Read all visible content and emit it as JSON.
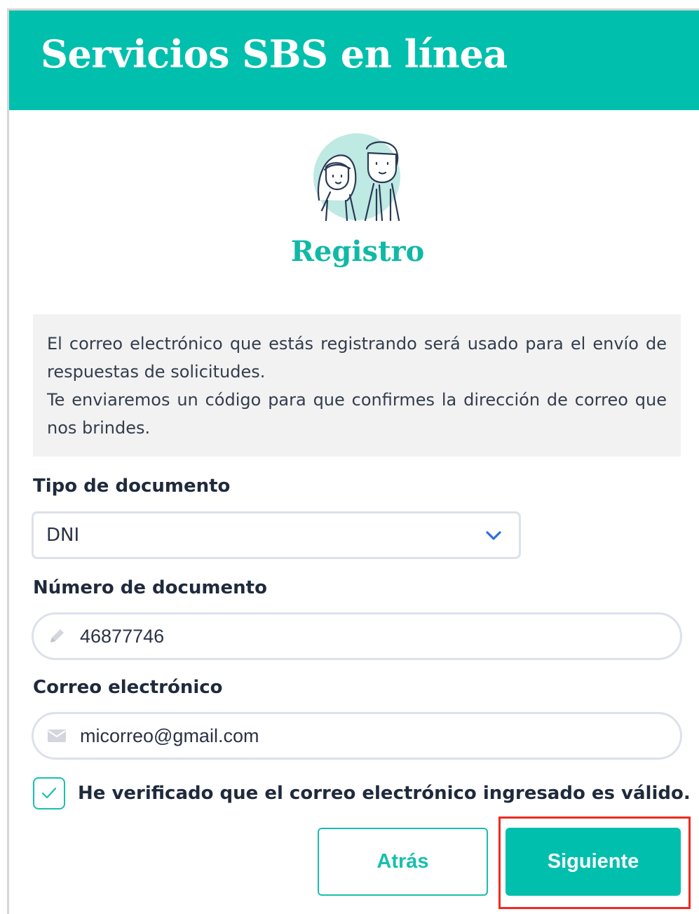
{
  "header": {
    "title": "Servicios SBS en línea"
  },
  "page": {
    "title": "Registro"
  },
  "notice": {
    "line1": "El correo electrónico que estás registrando será usado para el envío de respuestas de solicitudes.",
    "line2": "Te enviaremos un código para que confirmes la dirección de correo que nos brindes."
  },
  "form": {
    "doc_type": {
      "label": "Tipo de documento",
      "value": "DNI"
    },
    "doc_number": {
      "label": "Número de documento",
      "value": "46877746"
    },
    "email": {
      "label": "Correo electrónico",
      "value": "micorreo@gmail.com"
    },
    "verify": {
      "label": "He verificado que el correo electrónico ingresado es válido.",
      "checked": true
    }
  },
  "actions": {
    "back_label": "Atrás",
    "next_label": "Siguiente"
  },
  "colors": {
    "brand": "#00bfad",
    "highlight": "#ef2b1f",
    "chevron": "#2f6fe0"
  },
  "icons": {
    "avatar": "couple-illustration",
    "select": "chevron-down-icon",
    "doc_number": "pencil-icon",
    "email": "envelope-icon",
    "check": "check-icon"
  }
}
